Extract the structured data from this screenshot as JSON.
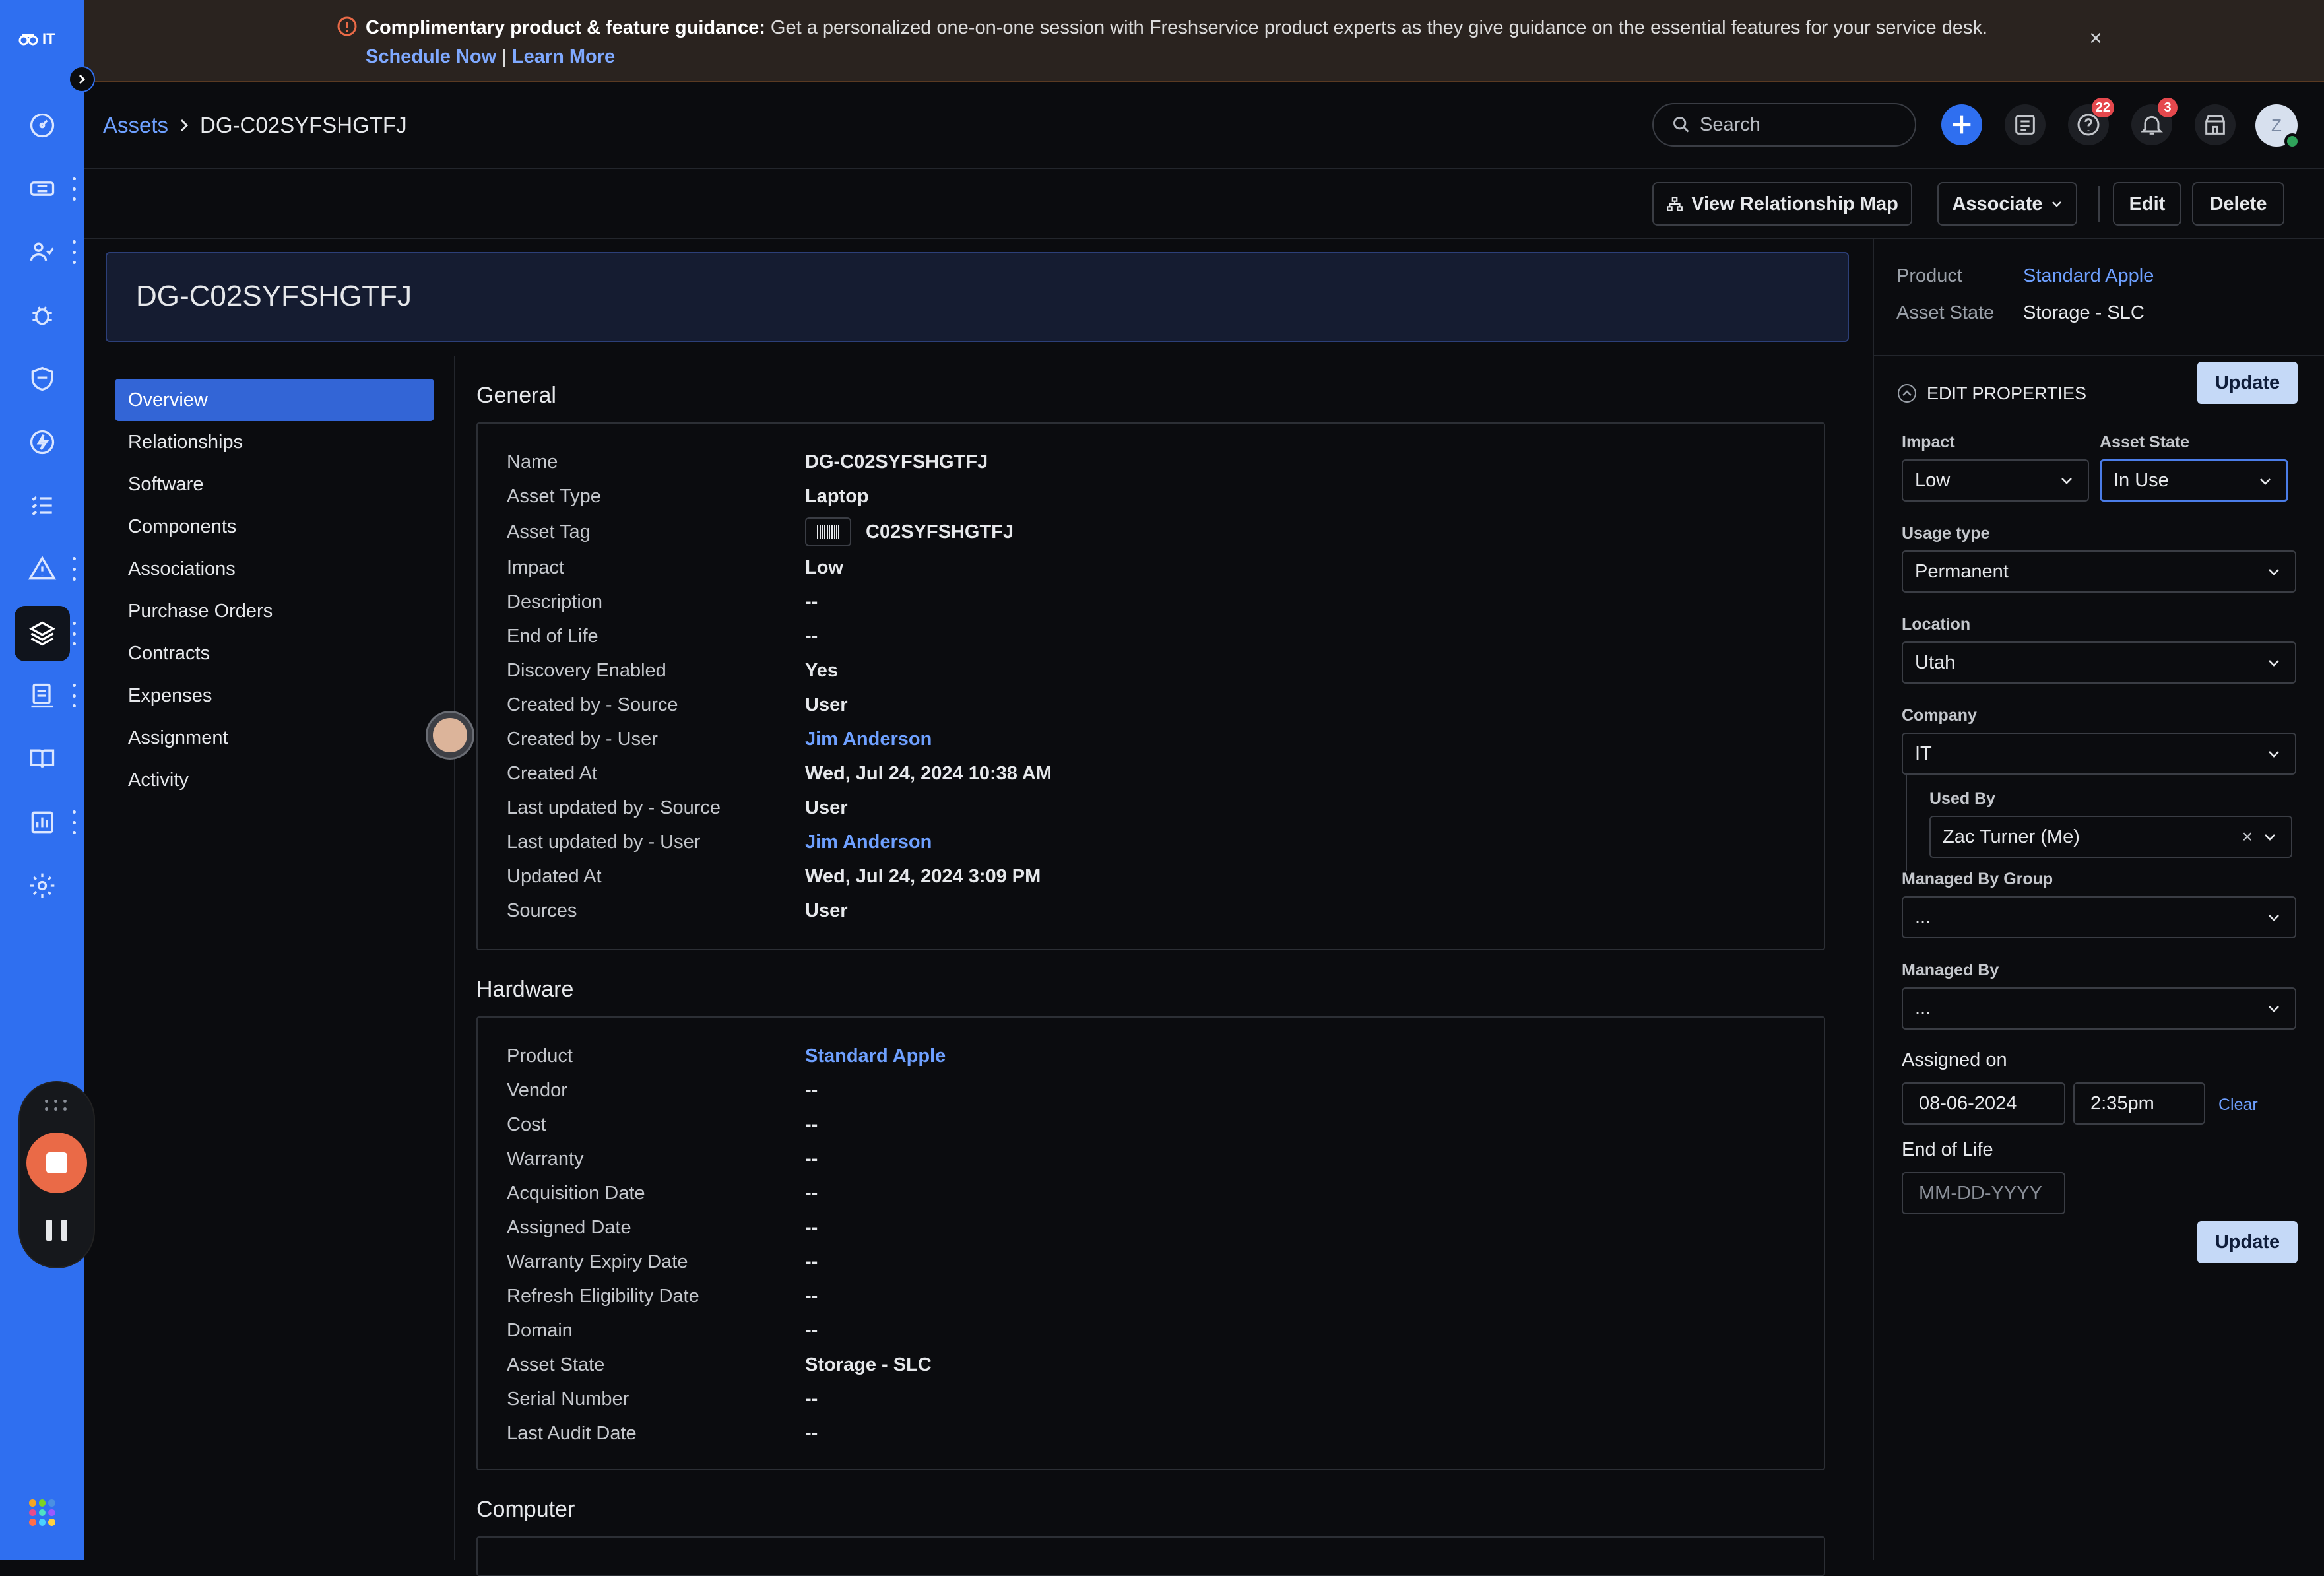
{
  "banner": {
    "bold": "Complimentary product & feature guidance:",
    "text": " Get a personalized one-on-one session with Freshservice product experts as they give guidance on the essential features for your service desk.",
    "schedule": "Schedule Now",
    "sep": " | ",
    "learn": "Learn More"
  },
  "rail": {
    "top_label": "IT"
  },
  "header": {
    "breadcrumb_root": "Assets",
    "breadcrumb_current": "DG-C02SYFSHGTFJ",
    "search_placeholder": "Search",
    "help_badge": "22",
    "notif_badge": "3",
    "avatar_initial": "Z"
  },
  "toolbar": {
    "relationship": "View Relationship Map",
    "associate": "Associate",
    "edit": "Edit",
    "delete": "Delete"
  },
  "page_title": "DG-C02SYFSHGTFJ",
  "nav": [
    "Overview",
    "Relationships",
    "Software",
    "Components",
    "Associations",
    "Purchase Orders",
    "Contracts",
    "Expenses",
    "Assignment",
    "Activity"
  ],
  "general": {
    "title": "General",
    "rows": [
      {
        "k": "Name",
        "v": "DG-C02SYFSHGTFJ"
      },
      {
        "k": "Asset Type",
        "v": "Laptop"
      },
      {
        "k": "Asset Tag",
        "v": "C02SYFSHGTFJ"
      },
      {
        "k": "Impact",
        "v": "Low"
      },
      {
        "k": "Description",
        "v": "--"
      },
      {
        "k": "End of Life",
        "v": "--"
      },
      {
        "k": "Discovery Enabled",
        "v": "Yes"
      },
      {
        "k": "Created by - Source",
        "v": "User"
      },
      {
        "k": "Created by - User",
        "v": "Jim Anderson"
      },
      {
        "k": "Created At",
        "v": "Wed, Jul 24, 2024 10:38 AM"
      },
      {
        "k": "Last updated by - Source",
        "v": "User"
      },
      {
        "k": "Last updated by - User",
        "v": "Jim Anderson"
      },
      {
        "k": "Updated At",
        "v": "Wed, Jul 24, 2024 3:09 PM"
      },
      {
        "k": "Sources",
        "v": "User"
      }
    ]
  },
  "hardware": {
    "title": "Hardware",
    "rows": [
      {
        "k": "Product",
        "v": "Standard Apple"
      },
      {
        "k": "Vendor",
        "v": "--"
      },
      {
        "k": "Cost",
        "v": "--"
      },
      {
        "k": "Warranty",
        "v": "--"
      },
      {
        "k": "Acquisition Date",
        "v": "--"
      },
      {
        "k": "Assigned Date",
        "v": "--"
      },
      {
        "k": "Warranty Expiry Date",
        "v": "--"
      },
      {
        "k": "Refresh Eligibility Date",
        "v": "--"
      },
      {
        "k": "Domain",
        "v": "--"
      },
      {
        "k": "Asset State",
        "v": "Storage - SLC"
      },
      {
        "k": "Serial Number",
        "v": "--"
      },
      {
        "k": "Last Audit Date",
        "v": "--"
      }
    ]
  },
  "computer": {
    "title": "Computer"
  },
  "panel": {
    "product_label": "Product",
    "product_value": "Standard Apple",
    "state_label": "Asset State",
    "state_value": "Storage - SLC",
    "edit_properties": "EDIT PROPERTIES",
    "update": "Update",
    "impact_label": "Impact",
    "impact_value": "Low",
    "asset_state_label": "Asset State",
    "asset_state_value": "In Use",
    "usage_label": "Usage type",
    "usage_value": "Permanent",
    "location_label": "Location",
    "location_value": "Utah",
    "company_label": "Company",
    "company_value": "IT",
    "used_by_label": "Used By",
    "used_by_value": "Zac Turner (Me)",
    "managed_group_label": "Managed By Group",
    "managed_group_value": "...",
    "managed_by_label": "Managed By",
    "managed_by_value": "...",
    "assigned_on_label": "Assigned on",
    "assigned_date": "08-06-2024",
    "assigned_time": "2:35pm",
    "clear": "Clear",
    "eol_label": "End of Life",
    "eol_placeholder": "MM-DD-YYYY"
  },
  "colors": {
    "accent": "#2f6ff0",
    "link": "#6ea0ff",
    "badge": "#e5484d",
    "record": "#ea6a47"
  }
}
